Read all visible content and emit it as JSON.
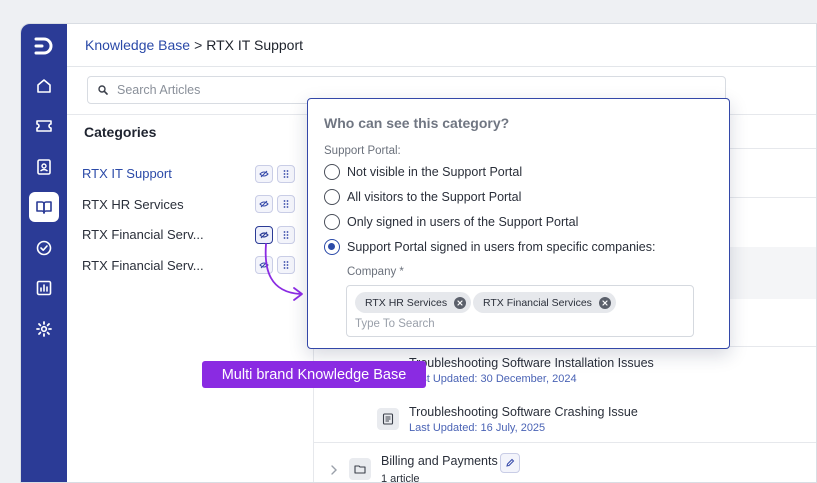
{
  "breadcrumb": {
    "parent": "Knowledge Base",
    "separator": ">",
    "current": "RTX IT Support"
  },
  "search": {
    "placeholder": "Search Articles"
  },
  "categories": {
    "heading": "Categories",
    "items": [
      {
        "label": "RTX IT Support",
        "active": true
      },
      {
        "label": "RTX HR Services",
        "active": false
      },
      {
        "label": "RTX Financial Serv...",
        "active": false
      },
      {
        "label": "RTX Financial Serv...",
        "active": false
      }
    ]
  },
  "visibility_popover": {
    "title": "Who can see this category?",
    "section_label": "Support Portal:",
    "options": [
      {
        "label": "Not visible in the Support Portal",
        "checked": false
      },
      {
        "label": "All visitors to the Support Portal",
        "checked": false
      },
      {
        "label": "Only signed in users of the Support Portal",
        "checked": false
      },
      {
        "label": "Support Portal signed in users from specific companies:",
        "checked": true
      }
    ],
    "company_label": "Company *",
    "companies": [
      "RTX HR Services",
      "RTX Financial Services"
    ],
    "company_placeholder": "Type To Search"
  },
  "articles": [
    {
      "title": "Troubleshooting Software Installation Issues",
      "updated": "Last Updated: 30 December, 2024"
    },
    {
      "title": "Troubleshooting Software Crashing Issue",
      "updated": "Last Updated: 16 July, 2025"
    }
  ],
  "folder": {
    "name": "Billing and Payments",
    "count": "1 article"
  },
  "callout": {
    "text": "Multi brand Knowledge Base"
  },
  "colors": {
    "sidebar": "#2b3b96",
    "accent": "#2b4aa8",
    "callout": "#8a2be2"
  },
  "sidebar_icons": [
    "logo-icon",
    "home-icon",
    "ticket-icon",
    "contact-icon",
    "knowledge-base-icon",
    "check-circle-icon",
    "reports-icon",
    "settings-icon"
  ]
}
